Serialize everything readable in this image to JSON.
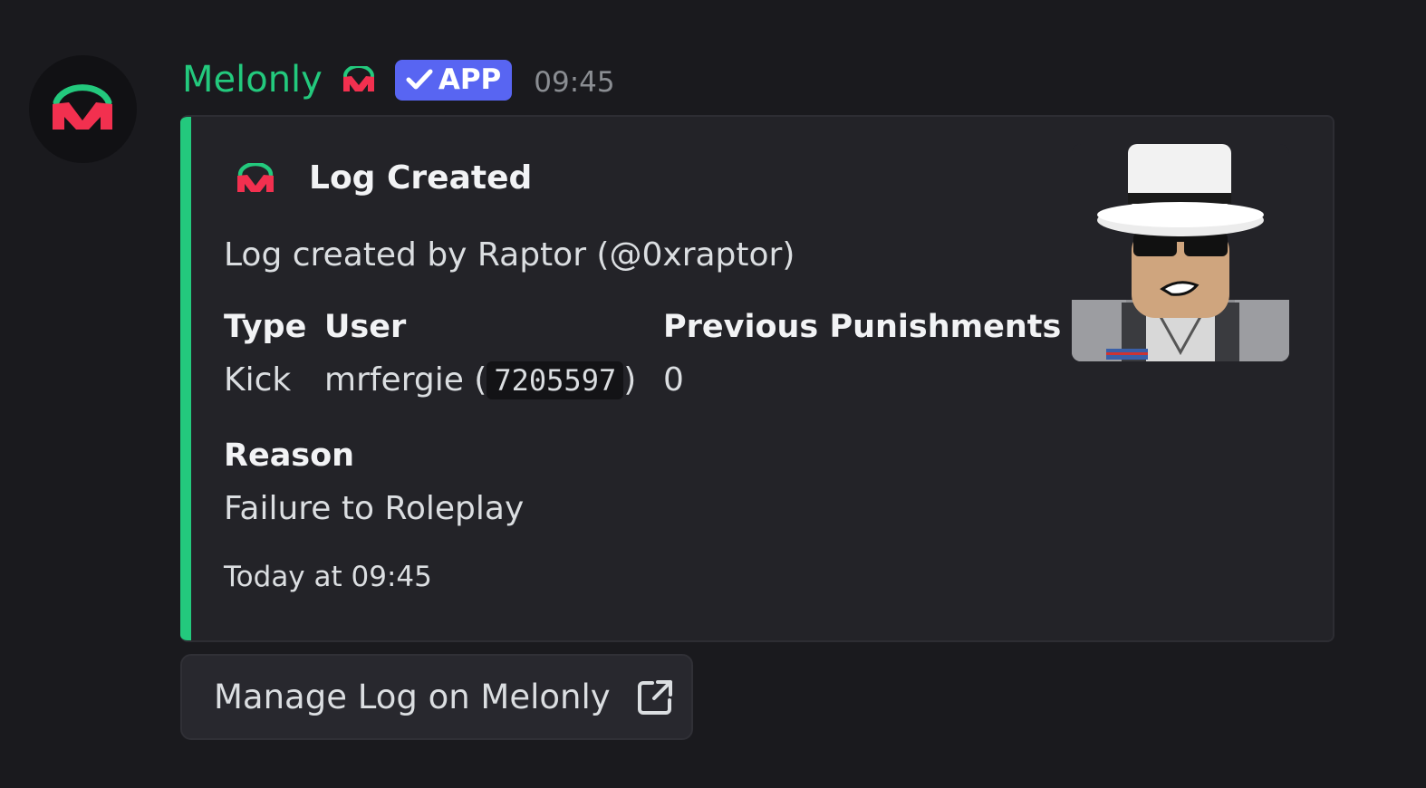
{
  "message": {
    "username": "Melonly",
    "badge": "APP",
    "timestamp": "09:45"
  },
  "embed": {
    "accent_color": "#23c97d",
    "author": "Log Created",
    "description": "Log created by Raptor (@0xraptor)",
    "fields": [
      {
        "name": "Type",
        "value": "Kick"
      },
      {
        "name": "User",
        "value_prefix": "mrfergie (",
        "value_code": "7205597",
        "value_suffix": ")"
      },
      {
        "name": "Previous Punishments",
        "value": "0"
      },
      {
        "name": "Reason",
        "value": "Failure to Roleplay"
      }
    ],
    "footer": "Today at 09:45",
    "thumbnail": "roblox-avatar-image"
  },
  "button": {
    "label": "Manage Log on Melonly",
    "icon": "external-link-icon"
  }
}
